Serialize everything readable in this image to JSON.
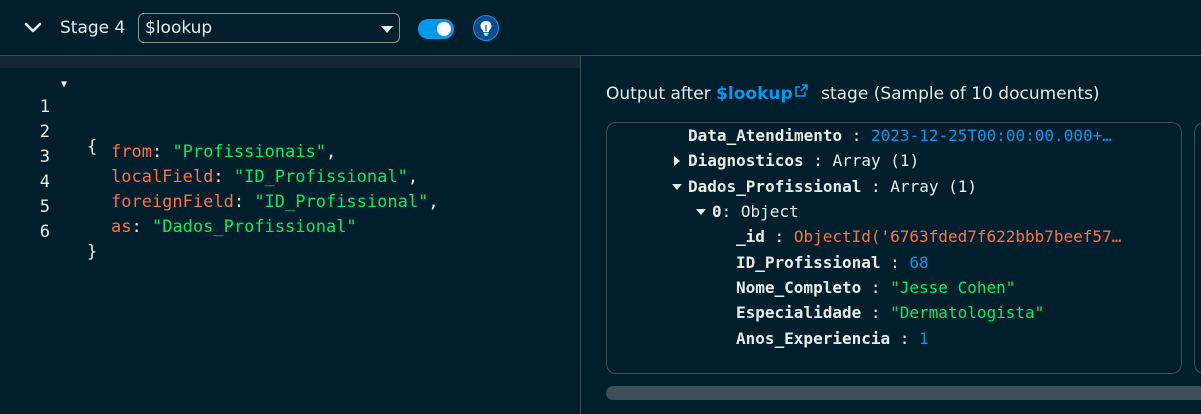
{
  "header": {
    "stage_label": "Stage 4",
    "operator_value": "$lookup",
    "toggle_enabled": true,
    "icons": [
      "chevron-down-icon",
      "caret-down-icon",
      "lightbulb-icon"
    ],
    "accent_color": "#0498ec"
  },
  "editor": {
    "line_numbers": [
      "1",
      "2",
      "3",
      "4",
      "5",
      "6"
    ],
    "open_brace": "{",
    "close_brace": "}",
    "fields": [
      {
        "key": "from",
        "value": "\"Profissionais\"",
        "trail": ","
      },
      {
        "key": "localField",
        "value": "\"ID_Profissional\"",
        "trail": ","
      },
      {
        "key": "foreignField",
        "value": "\"ID_Profissional\"",
        "trail": ","
      },
      {
        "key": "as",
        "value": "\"Dados_Profissional\"",
        "trail": ""
      }
    ]
  },
  "output": {
    "title_prefix": "Output after",
    "stage_link": "$lookup",
    "title_suffix": "stage (Sample of 10 documents)",
    "doc": {
      "data_atendimento": {
        "key": "Data_Atendimento",
        "value": "2023-12-25T00:00:00.000+…"
      },
      "diagnosticos": {
        "key": "Diagnosticos",
        "value": "Array (1)"
      },
      "dados_profissional": {
        "key": "Dados_Profissional",
        "value": "Array (1)"
      },
      "item0": {
        "key": "0",
        "value": "Object"
      },
      "id": {
        "key": "_id",
        "value": "ObjectId('6763fded7f622bbb7beef57…"
      },
      "id_profissional": {
        "key": "ID_Profissional",
        "value": "68"
      },
      "nome_completo": {
        "key": "Nome_Completo",
        "value": "\"Jesse Cohen\""
      },
      "especialidade": {
        "key": "Especialidade",
        "value": "\"Dermatologista\""
      },
      "anos_experiencia": {
        "key": "Anos_Experiencia",
        "value": "1"
      }
    }
  }
}
